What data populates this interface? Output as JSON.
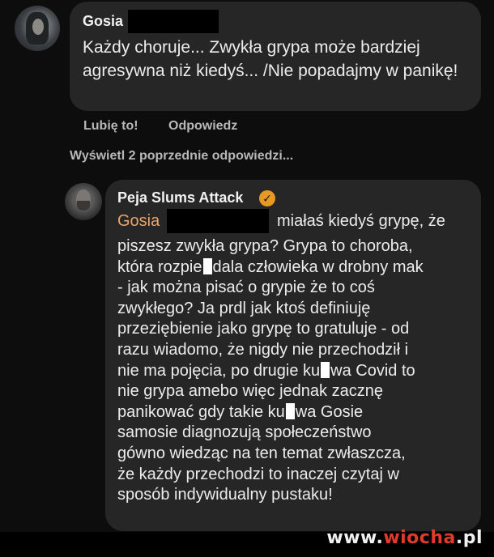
{
  "comment": {
    "author": "Gosia",
    "text": "Każdy choruje... Zwykła grypa może bardziej agresywna niż kiedyś... /Nie popadajmy w panikę!",
    "like_label": "Lubię to!",
    "reply_label": "Odpowiedz"
  },
  "view_previous_label": "Wyświetl 2 poprzednie odpowiedzi...",
  "reply": {
    "author": "Peja Slums Attack",
    "verified_icon": "check",
    "mention": "Gosia",
    "lines": {
      "l1": "miałaś kiedyś grypę, że",
      "l2": "piszesz zwykła grypa? Grypa to choroba,",
      "l3a": "która rozpie",
      "l3b": "dala człowieka w drobny mak",
      "l4": "- jak można pisać o grypie że to coś",
      "l5": "zwykłego? Ja prdl jak ktoś definiuję",
      "l6": "przeziębienie jako grypę to gratuluje - od",
      "l7": "razu wiadomo, że nigdy nie przechodził i",
      "l8a": "nie ma pojęcia, po drugie ku",
      "l8b": "wa Covid to",
      "l9": "nie grypa amebo więc jednak zacznę",
      "l10a": "panikować gdy takie ku",
      "l10b": "wa Gosie",
      "l11": "samosie diagnozują społeczeństwo",
      "l12": "gówno wiedząc na ten temat zwłaszcza,",
      "l13": "że każdy przechodzi to inaczej czytaj w",
      "l14": "sposób indywidualny pustaku!"
    }
  },
  "watermark": {
    "part1": "www.",
    "part2": "wiocha",
    "part3": ".pl"
  },
  "colors": {
    "background": "#0d0d0d",
    "bubble": "#262626",
    "mention": "#e7a46c",
    "verified": "#e69a24",
    "watermark_accent": "#e03a2b"
  }
}
